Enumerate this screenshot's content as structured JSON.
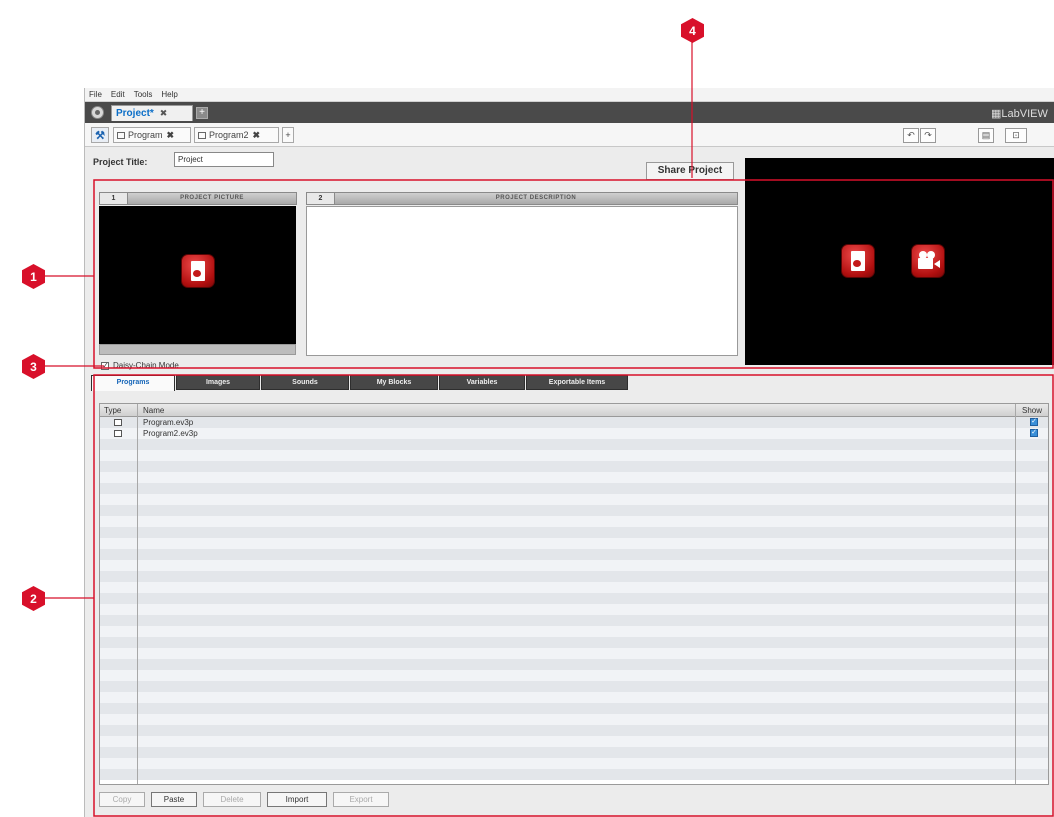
{
  "menu": [
    "File",
    "Edit",
    "Tools",
    "Help"
  ],
  "project_tab": {
    "label": "Project*",
    "close": "✖",
    "add": "+"
  },
  "brand": "LabVIEW",
  "program_tabs": [
    {
      "label": "Program",
      "close": "✖"
    },
    {
      "label": "Program2",
      "close": "✖"
    }
  ],
  "add_program": "+",
  "project_title": {
    "label": "Project Title:",
    "value": "Project"
  },
  "share_button": "Share Project",
  "picture_panel": {
    "number": "1",
    "title": "PROJECT PICTURE"
  },
  "description_panel": {
    "number": "2",
    "title": "PROJECT DESCRIPTION"
  },
  "daisy_chain": {
    "label": "Daisy-Chain Mode",
    "checked": true
  },
  "tabs": [
    "Programs",
    "Images",
    "Sounds",
    "My Blocks",
    "Variables",
    "Exportable Items"
  ],
  "table": {
    "headers": {
      "type": "Type",
      "name": "Name",
      "show": "Show"
    },
    "rows": [
      {
        "name": "Program.ev3p",
        "show": true
      },
      {
        "name": "Program2.ev3p",
        "show": true
      }
    ]
  },
  "buttons": [
    "Copy",
    "Paste",
    "Delete",
    "Import",
    "Export"
  ],
  "callouts": [
    "1",
    "2",
    "3",
    "4"
  ],
  "colors": {
    "accent_red": "#d8102a",
    "tab_blue": "#1565b8",
    "dark_bar": "#474747"
  }
}
